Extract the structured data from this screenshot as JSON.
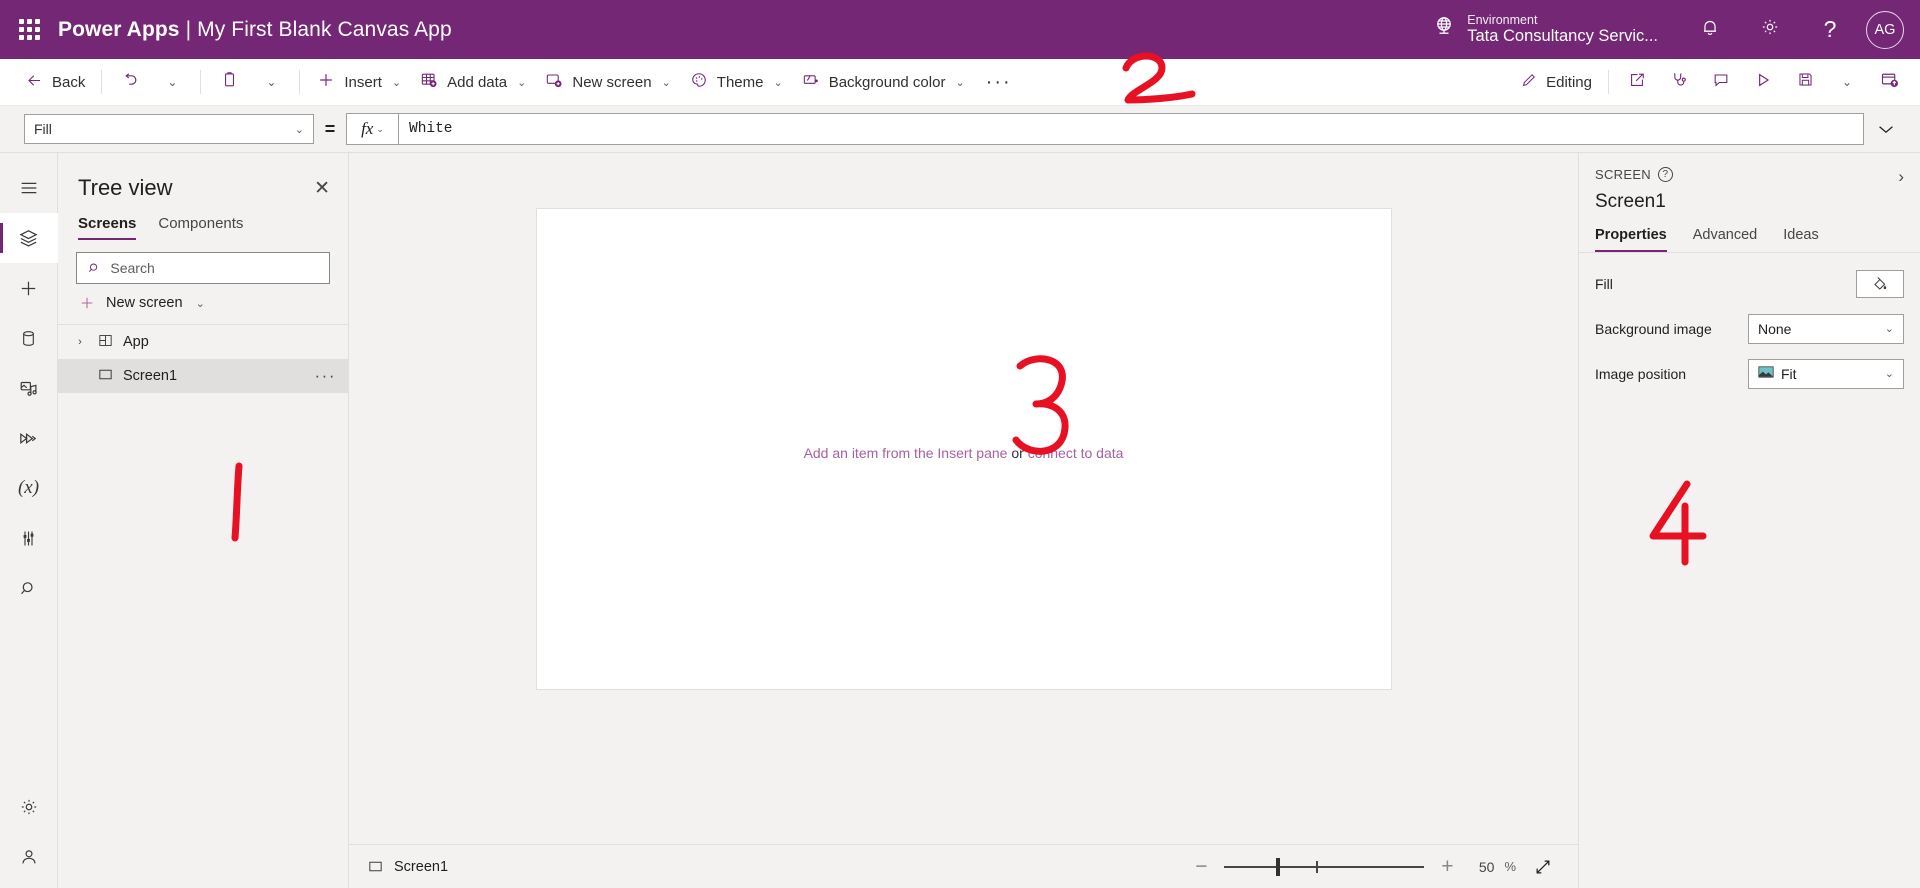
{
  "header": {
    "waffle_icon": "waffle-grid-icon",
    "brand": "Power Apps",
    "separator": "|",
    "app_name": "My First Blank Canvas App",
    "environment_label": "Environment",
    "environment_value": "Tata Consultancy Servic...",
    "environment_icon": "globe-icon",
    "notifications_icon": "bell-icon",
    "settings_icon": "gear-icon",
    "help_icon": "question-mark-icon",
    "avatar_initials": "AG",
    "background_color": "#742774"
  },
  "commandbar": {
    "back": "Back",
    "undo_icon": "undo-icon",
    "undo_chevron": "⌄",
    "paste_icon": "clipboard-icon",
    "paste_chevron": "⌄",
    "insert": "Insert",
    "insert_icon": "plus-icon",
    "add_data": "Add data",
    "add_data_icon": "table-add-icon",
    "new_screen": "New screen",
    "new_screen_icon": "screen-add-icon",
    "theme": "Theme",
    "theme_icon": "palette-icon",
    "background_color": "Background color",
    "background_color_icon": "paint-bucket-icon",
    "overflow": "···",
    "editing": "Editing",
    "editing_icon": "pencil-icon",
    "share_icon": "share-icon",
    "checker_icon": "stethoscope-icon",
    "comments_icon": "comment-icon",
    "preview_icon": "play-icon",
    "save_icon": "save-icon",
    "save_chevron": "⌄",
    "publish_icon": "publish-icon",
    "chevron": "⌄"
  },
  "formulabar": {
    "property": "Fill",
    "equals": "=",
    "fx_glyph": "fx",
    "fx_chevron": "⌄",
    "value": "White",
    "expand_icon": "chevron-down-icon",
    "chevron": "⌄"
  },
  "rail": {
    "items": [
      {
        "name": "hamburger-menu",
        "icon": "hamburger-icon"
      },
      {
        "name": "tree-view",
        "icon": "layers-icon",
        "active": true
      },
      {
        "name": "insert",
        "icon": "plus-icon"
      },
      {
        "name": "data",
        "icon": "database-icon"
      },
      {
        "name": "media",
        "icon": "media-icon"
      },
      {
        "name": "power-automate",
        "icon": "flow-icon"
      },
      {
        "name": "variables",
        "icon": "variable-x-icon"
      },
      {
        "name": "advanced-tools",
        "icon": "tools-icon"
      },
      {
        "name": "search",
        "icon": "search-icon"
      }
    ],
    "bottom_items": [
      {
        "name": "settings",
        "icon": "gear-icon"
      },
      {
        "name": "account",
        "icon": "person-icon"
      }
    ]
  },
  "treeview": {
    "title": "Tree view",
    "close_icon": "close-icon",
    "tabs": [
      {
        "label": "Screens",
        "active": true
      },
      {
        "label": "Components",
        "active": false
      }
    ],
    "search_placeholder": "Search",
    "search_value": "",
    "search_icon": "search-icon",
    "new_screen": "New screen",
    "new_screen_icon": "plus-icon",
    "new_screen_chevron": "⌄",
    "rows": [
      {
        "label": "App",
        "icon": "app-grid-icon",
        "expander": "›",
        "selected": false,
        "has_dots": false
      },
      {
        "label": "Screen1",
        "icon": "screen-rect-icon",
        "expander": "",
        "selected": true,
        "has_dots": true,
        "dots": "···"
      }
    ]
  },
  "canvas": {
    "hint_prefix": "Add an item from the Insert pane",
    "hint_middle": " or ",
    "hint_suffix": "connect to data",
    "fill_color": "#ffffff"
  },
  "statusbar": {
    "screen_name": "Screen1",
    "screen_icon": "screen-rect-icon",
    "zoom_minus": "−",
    "zoom_plus": "+",
    "zoom_value": "50",
    "zoom_unit": "%",
    "fit_icon": "fit-to-screen-icon"
  },
  "properties": {
    "kicker": "SCREEN",
    "help_icon": "question-mark-icon",
    "help_glyph": "?",
    "collapse_icon": "chevron-right-icon",
    "collapse_glyph": "›",
    "name": "Screen1",
    "tabs": [
      {
        "label": "Properties",
        "active": true
      },
      {
        "label": "Advanced",
        "active": false
      },
      {
        "label": "Ideas",
        "active": false
      }
    ],
    "rows": [
      {
        "label": "Fill",
        "control": "swatch",
        "icon": "paint-bucket-icon",
        "value": ""
      },
      {
        "label": "Background image",
        "control": "dropdown",
        "value": "None",
        "icon": "",
        "chevron": "⌄"
      },
      {
        "label": "Image position",
        "control": "dropdown",
        "value": "Fit",
        "icon": "image-icon",
        "chevron": "⌄"
      }
    ]
  },
  "annotations": {
    "marks": [
      {
        "text": "1",
        "target": "tree-view-panel"
      },
      {
        "text": "2",
        "target": "command-bar-overflow"
      },
      {
        "text": "3",
        "target": "canvas"
      },
      {
        "text": "4",
        "target": "properties-panel"
      }
    ],
    "color": "#e81123"
  }
}
